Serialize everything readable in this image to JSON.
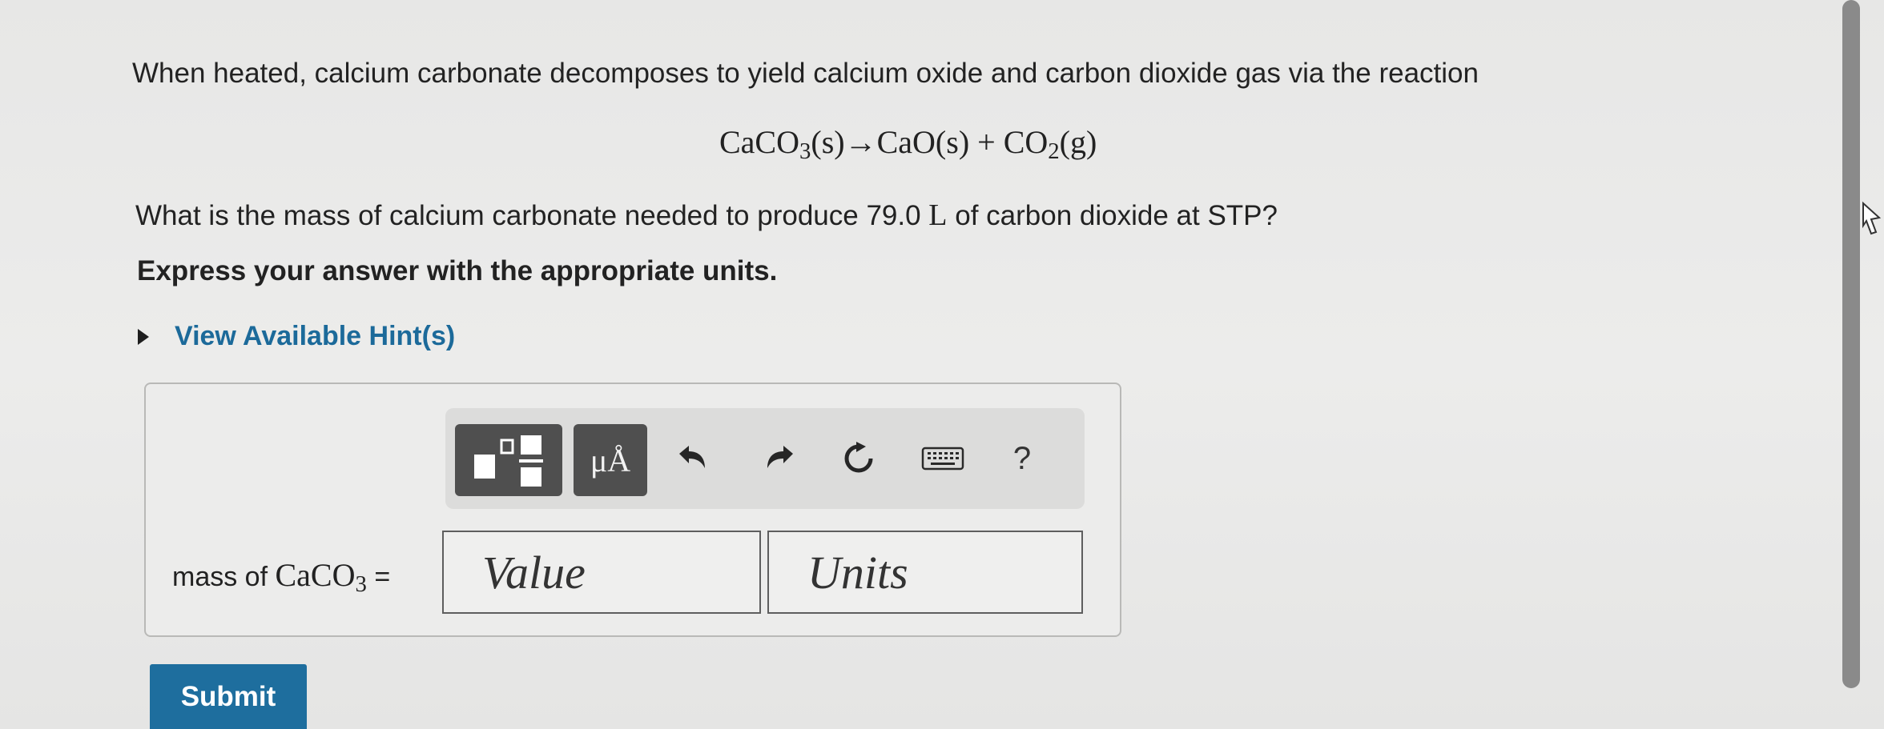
{
  "problem": {
    "intro": "When heated, calcium carbonate decomposes to yield calcium oxide and carbon dioxide gas via the reaction",
    "equation": {
      "caco3_main": "CaCO",
      "caco3_sub": "3",
      "middle": "(s)→CaO(s) + CO",
      "co2_sub": "2",
      "end": "(g)"
    },
    "question_prefix": "What is the mass of calcium carbonate needed to produce 79.0 ",
    "question_unit": "L",
    "question_suffix": " of carbon dioxide at STP?",
    "instruction": "Express your answer with the appropriate units."
  },
  "hint": {
    "label": "View Available Hint(s)"
  },
  "toolbar": {
    "units_label": "μÅ",
    "help_label": "?"
  },
  "answer": {
    "label_prefix": "mass of ",
    "label_chem_main": "CaCO",
    "label_chem_sub": "3",
    "label_equals": " =",
    "value_placeholder": "Value",
    "units_placeholder": "Units"
  },
  "submit": {
    "label": "Submit"
  }
}
